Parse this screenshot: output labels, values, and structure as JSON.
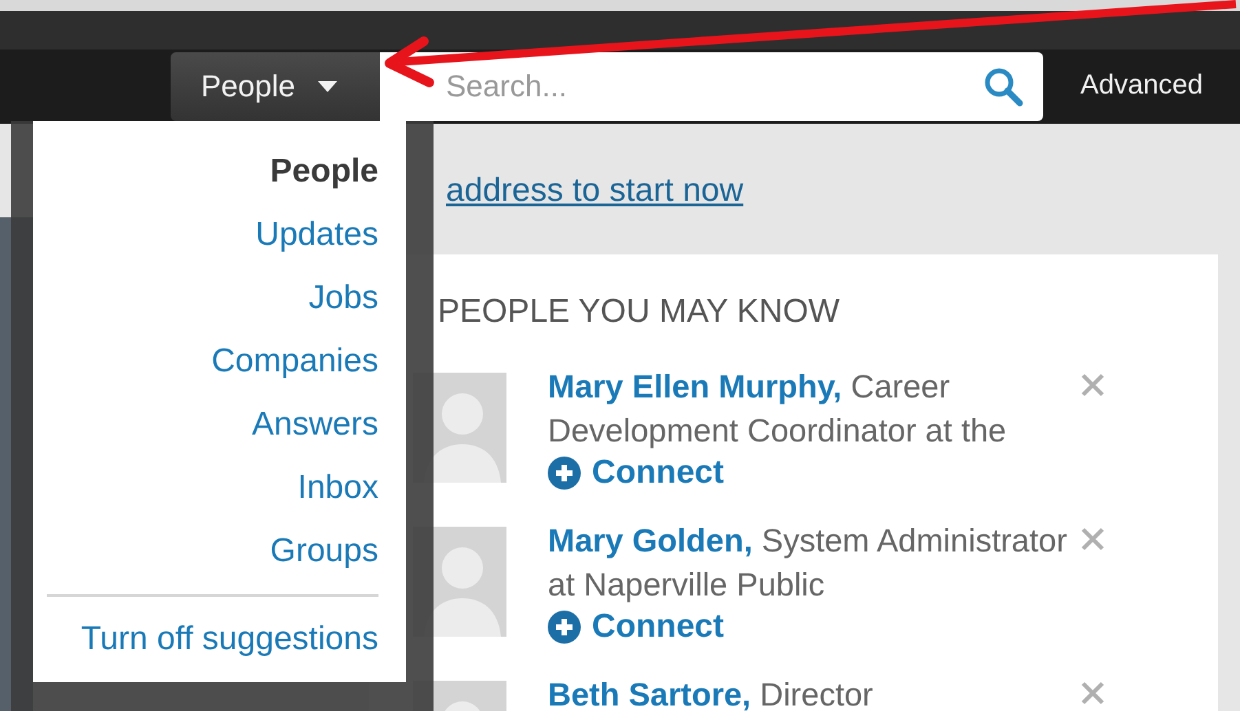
{
  "header": {
    "scope_button": {
      "label": "People"
    },
    "search": {
      "placeholder": "Search..."
    },
    "advanced_link": "Advanced"
  },
  "banner": {
    "link": "address to start now"
  },
  "scope_menu": {
    "items": [
      {
        "label": "People",
        "selected": true
      },
      {
        "label": "Updates",
        "selected": false
      },
      {
        "label": "Jobs",
        "selected": false
      },
      {
        "label": "Companies",
        "selected": false
      },
      {
        "label": "Answers",
        "selected": false
      },
      {
        "label": "Inbox",
        "selected": false
      },
      {
        "label": "Groups",
        "selected": false
      }
    ],
    "footer_item": "Turn off suggestions"
  },
  "suggestions": {
    "title": "PEOPLE YOU MAY KNOW",
    "people": [
      {
        "name": "Mary Ellen Murphy,",
        "headline": "Career Development Coordinator at the",
        "action": "Connect"
      },
      {
        "name": "Mary Golden,",
        "headline": "System Administrator at Naperville Public",
        "action": "Connect"
      },
      {
        "name": "Beth Sartore,",
        "headline": "Director"
      }
    ]
  }
}
